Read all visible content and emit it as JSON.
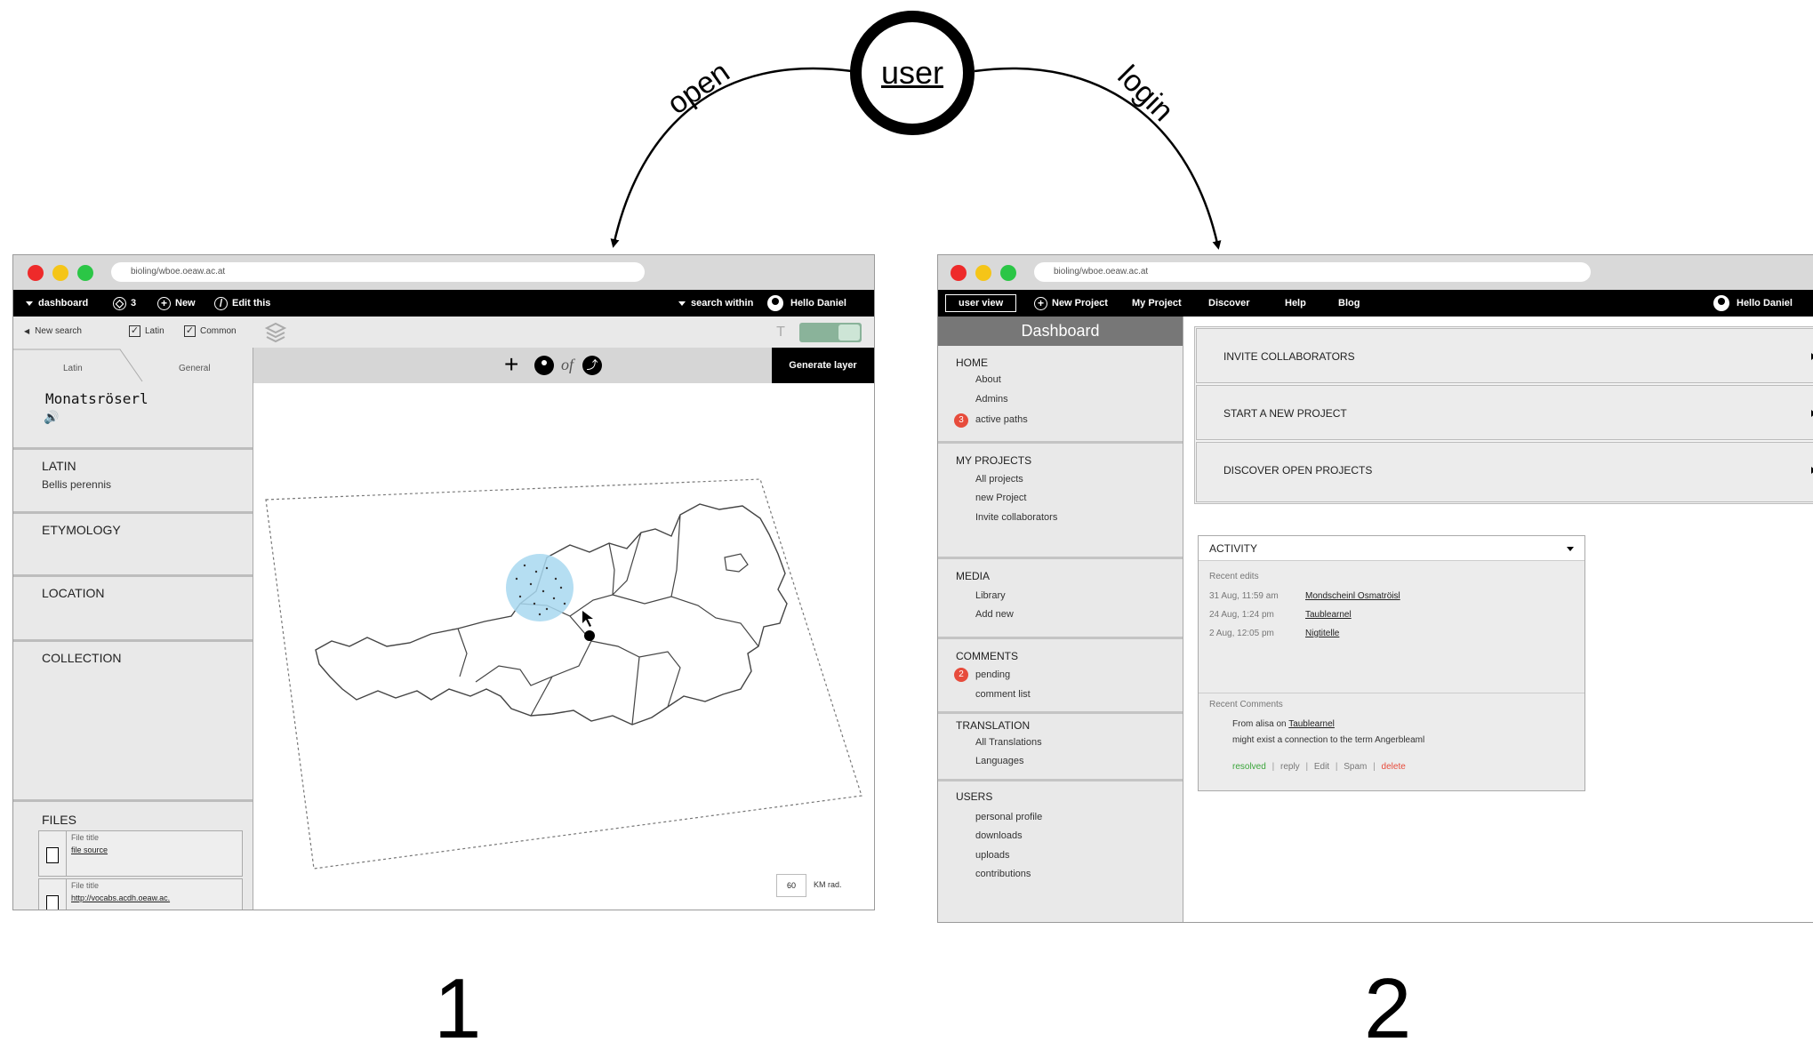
{
  "flow": {
    "user_label": "user",
    "open_label": "open",
    "login_label": "login",
    "num_left": "1",
    "num_right": "2"
  },
  "colors": {
    "close": "#ee2a2a",
    "minimize": "#f5c518",
    "maximize": "#2bc646",
    "highlight": "#a8d8f0",
    "badge": "#e74c3c",
    "resolved": "#3aa53a",
    "delete": "#e74c3c"
  },
  "window1": {
    "url": "bioling/wboe.oeaw.ac.at",
    "topbar": {
      "dashboard": "dashboard",
      "count": "3",
      "new": "New",
      "edit": "Edit this",
      "search_within": "search within",
      "user": "Hello Daniel"
    },
    "toolrow": {
      "new_search": "New search",
      "latin": "Latin",
      "common": "Common"
    },
    "tabs": [
      "Latin",
      "General"
    ],
    "entry_title": "Monatsröserl",
    "sections": {
      "latin": "LATIN",
      "latin_value": "Bellis perennis",
      "etymology": "ETYMOLOGY",
      "location": "LOCATION",
      "collection": "COLLECTION",
      "files": "FILES"
    },
    "files": [
      {
        "title": "File title",
        "source": "file source"
      },
      {
        "title": "File title",
        "source": "http://vocabs.acdh.oeaw.ac."
      }
    ],
    "map_toolbar": {
      "of": "of",
      "generate": "Generate layer"
    },
    "radius_value": "60",
    "radius_unit": "KM rad."
  },
  "window2": {
    "url": "bioling/wboe.oeaw.ac.at",
    "topbar": {
      "user_view": "user view",
      "new_project": "New Project",
      "my_project": "My Project",
      "discover": "Discover",
      "help": "Help",
      "blog": "Blog",
      "user": "Hello Daniel"
    },
    "sidebar_title": "Dashboard",
    "sidebar": {
      "home": "HOME",
      "about": "About",
      "admins": "Admins",
      "active_paths": "active paths",
      "active_badge": "3",
      "my_projects": "MY PROJECTS",
      "all_projects": "All projects",
      "new_project": "new Project",
      "invite": "Invite collaborators",
      "media": "MEDIA",
      "library": "Library",
      "add_new": "Add new",
      "comments": "COMMENTS",
      "pending": "pending",
      "pending_badge": "2",
      "comment_list": "comment list",
      "translation": "TRANSLATION",
      "all_translations": "All Translations",
      "languages": "Languages",
      "users": "USERS",
      "personal_profile": "personal profile",
      "downloads": "downloads",
      "uploads": "uploads",
      "contributions": "contributions"
    },
    "actions": [
      "INVITE COLLABORATORS",
      "START A NEW PROJECT",
      "DISCOVER OPEN PROJECTS"
    ],
    "activity": {
      "title": "ACTIVITY",
      "recent_edits": "Recent edits",
      "edits": [
        {
          "time": "31 Aug, 11:59 am",
          "name": "Mondscheinl Osmatröisl"
        },
        {
          "time": "24 Aug, 1:24 pm",
          "name": "Taublearnel"
        },
        {
          "time": "2 Aug, 12:05 pm",
          "name": "Nigtitelle"
        }
      ],
      "recent_comments": "Recent Comments",
      "comment_from": "From alisa on",
      "comment_target": "Taublearnel",
      "comment_text": "might exist a connection to the term Angerbleaml",
      "resolved": "resolved",
      "reply": "reply",
      "edit": "Edit",
      "spam": "Spam",
      "delete": "delete"
    }
  }
}
